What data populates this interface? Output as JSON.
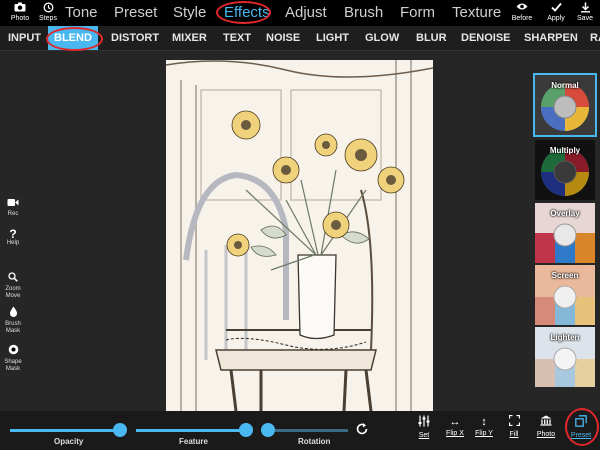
{
  "topbar": {
    "photo_label": "Photo",
    "steps_label": "Steps",
    "menu": [
      "Tone",
      "Preset",
      "Style",
      "Effects",
      "Adjust",
      "Brush",
      "Form",
      "Texture"
    ],
    "active_menu": "Effects",
    "before_label": "Before",
    "apply_label": "Apply",
    "save_label": "Save"
  },
  "submenu": {
    "items": [
      "INPUT",
      "BLEND",
      "DISTORT",
      "MIXER",
      "TEXT",
      "NOISE",
      "LIGHT",
      "GLOW",
      "BLUR",
      "DENOISE",
      "SHARPEN",
      "RA"
    ],
    "active": "BLEND"
  },
  "left_tools": {
    "rec": "Rec",
    "help": "Help",
    "zoom_move": [
      "Zoom",
      "Move"
    ],
    "brush_mask": [
      "Brush",
      "Mask"
    ],
    "shape_mask": [
      "Shape",
      "Mask"
    ]
  },
  "presets": {
    "items": [
      "Normal",
      "Multiply",
      "Overlay",
      "Screen",
      "Lighten"
    ],
    "selected": "Normal"
  },
  "bottombar": {
    "sliders": [
      {
        "label": "Opacity",
        "value": 1.0
      },
      {
        "label": "Feature",
        "value": 1.0
      },
      {
        "label": "Rotation",
        "value": 0.0
      }
    ],
    "set_label": "Set",
    "flip_x_label": "Flip X",
    "flip_y_label": "Flip Y",
    "fill_label": "Fill",
    "photo_label": "Photo",
    "preset_label": "Preset"
  },
  "colors": {
    "accent": "#4ab8f0",
    "highlight_ring": "#e0282c",
    "background": "#262626"
  }
}
